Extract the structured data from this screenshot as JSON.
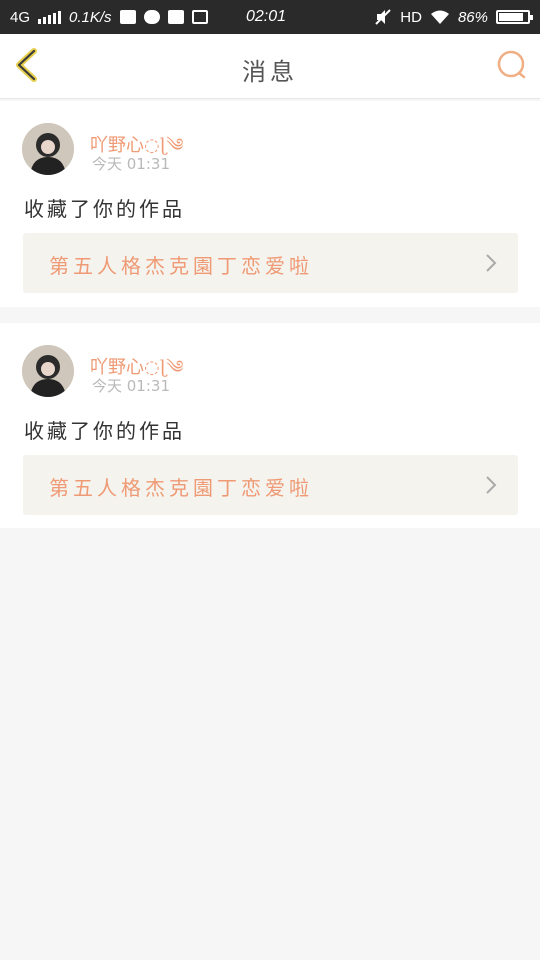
{
  "status_bar": {
    "network": "4G",
    "speed": "0.1K/s",
    "time": "02:01",
    "hd": "HD",
    "battery": "86%",
    "battery_level": 0.86,
    "icons": [
      "signal-icon",
      "mail-icon",
      "chat-icon",
      "video-icon",
      "screenshot-icon",
      "mute-icon",
      "wifi-icon",
      "battery-icon"
    ]
  },
  "header": {
    "title": "消息",
    "back_icon": "chevron-left-icon",
    "search_icon": "search-icon"
  },
  "colors": {
    "accent": "#ef9a74",
    "back_arrow": "#e6cf4e",
    "background": "#f6f6f6"
  },
  "messages": [
    {
      "username": "吖野心◌ɭ༄",
      "time": "今天 01:31",
      "action": "收藏了你的作品",
      "work_title": "第五人格杰克園丁恋爱啦"
    },
    {
      "username": "吖野心◌ɭ༄",
      "time": "今天 01:31",
      "action": "收藏了你的作品",
      "work_title": "第五人格杰克園丁恋爱啦"
    }
  ]
}
